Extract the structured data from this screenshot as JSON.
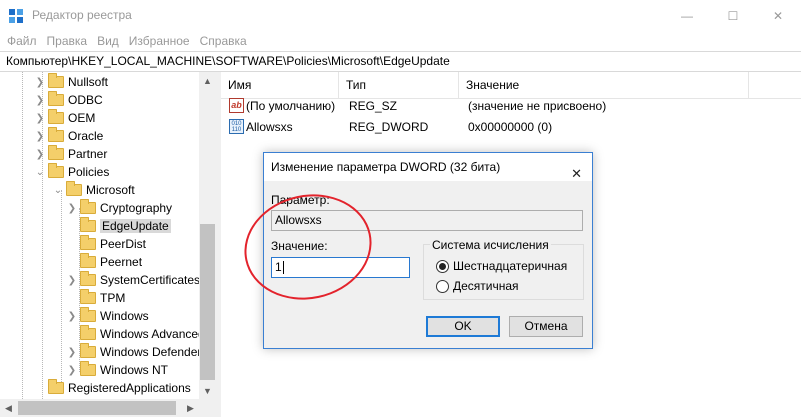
{
  "window": {
    "title": "Редактор реестра",
    "minimize_glyph": "—",
    "maximize_glyph": "☐",
    "close_glyph": "✕"
  },
  "menu": [
    "Файл",
    "Правка",
    "Вид",
    "Избранное",
    "Справка"
  ],
  "address": "Компьютер\\HKEY_LOCAL_MACHINE\\SOFTWARE\\Policies\\Microsoft\\EdgeUpdate",
  "tree": {
    "items": [
      {
        "label": "Nullsoft"
      },
      {
        "label": "ODBC"
      },
      {
        "label": "OEM"
      },
      {
        "label": "Oracle"
      },
      {
        "label": "Partner"
      },
      {
        "label": "Policies"
      },
      {
        "label": "Microsoft"
      },
      {
        "label": "Cryptography"
      },
      {
        "label": "EdgeUpdate"
      },
      {
        "label": "PeerDist"
      },
      {
        "label": "Peernet"
      },
      {
        "label": "SystemCertificates"
      },
      {
        "label": "TPM"
      },
      {
        "label": "Windows"
      },
      {
        "label": "Windows Advanced"
      },
      {
        "label": "Windows Defender"
      },
      {
        "label": "Windows NT"
      },
      {
        "label": "RegisteredApplications"
      }
    ],
    "selected": "EdgeUpdate"
  },
  "list": {
    "columns": [
      "Имя",
      "Тип",
      "Значение"
    ],
    "rows": [
      {
        "name": "(По умолчанию)",
        "type": "REG_SZ",
        "value": "(значение не присвоено)",
        "icon": "string-value-icon",
        "icon_text": "ab"
      },
      {
        "name": "Allowsxs",
        "type": "REG_DWORD",
        "value": "0x00000000 (0)",
        "icon": "binary-value-icon",
        "icon_text": "010 110"
      }
    ]
  },
  "dialog": {
    "title": "Изменение параметра DWORD (32 бита)",
    "close_glyph": "✕",
    "param_label": "Параметр:",
    "param_value": "Allowsxs",
    "value_label": "Значение:",
    "value_input": "1",
    "base_group_label": "Система исчисления",
    "radio_hex": "Шестнадцатеричная",
    "radio_dec": "Десятичная",
    "selected_base": "hex",
    "ok_label": "OK",
    "cancel_label": "Отмена"
  },
  "colors": {
    "highlight_ring": "#e3232c",
    "dialog_border": "#3a7fd2",
    "default_button_border": "#1e7ad6"
  }
}
